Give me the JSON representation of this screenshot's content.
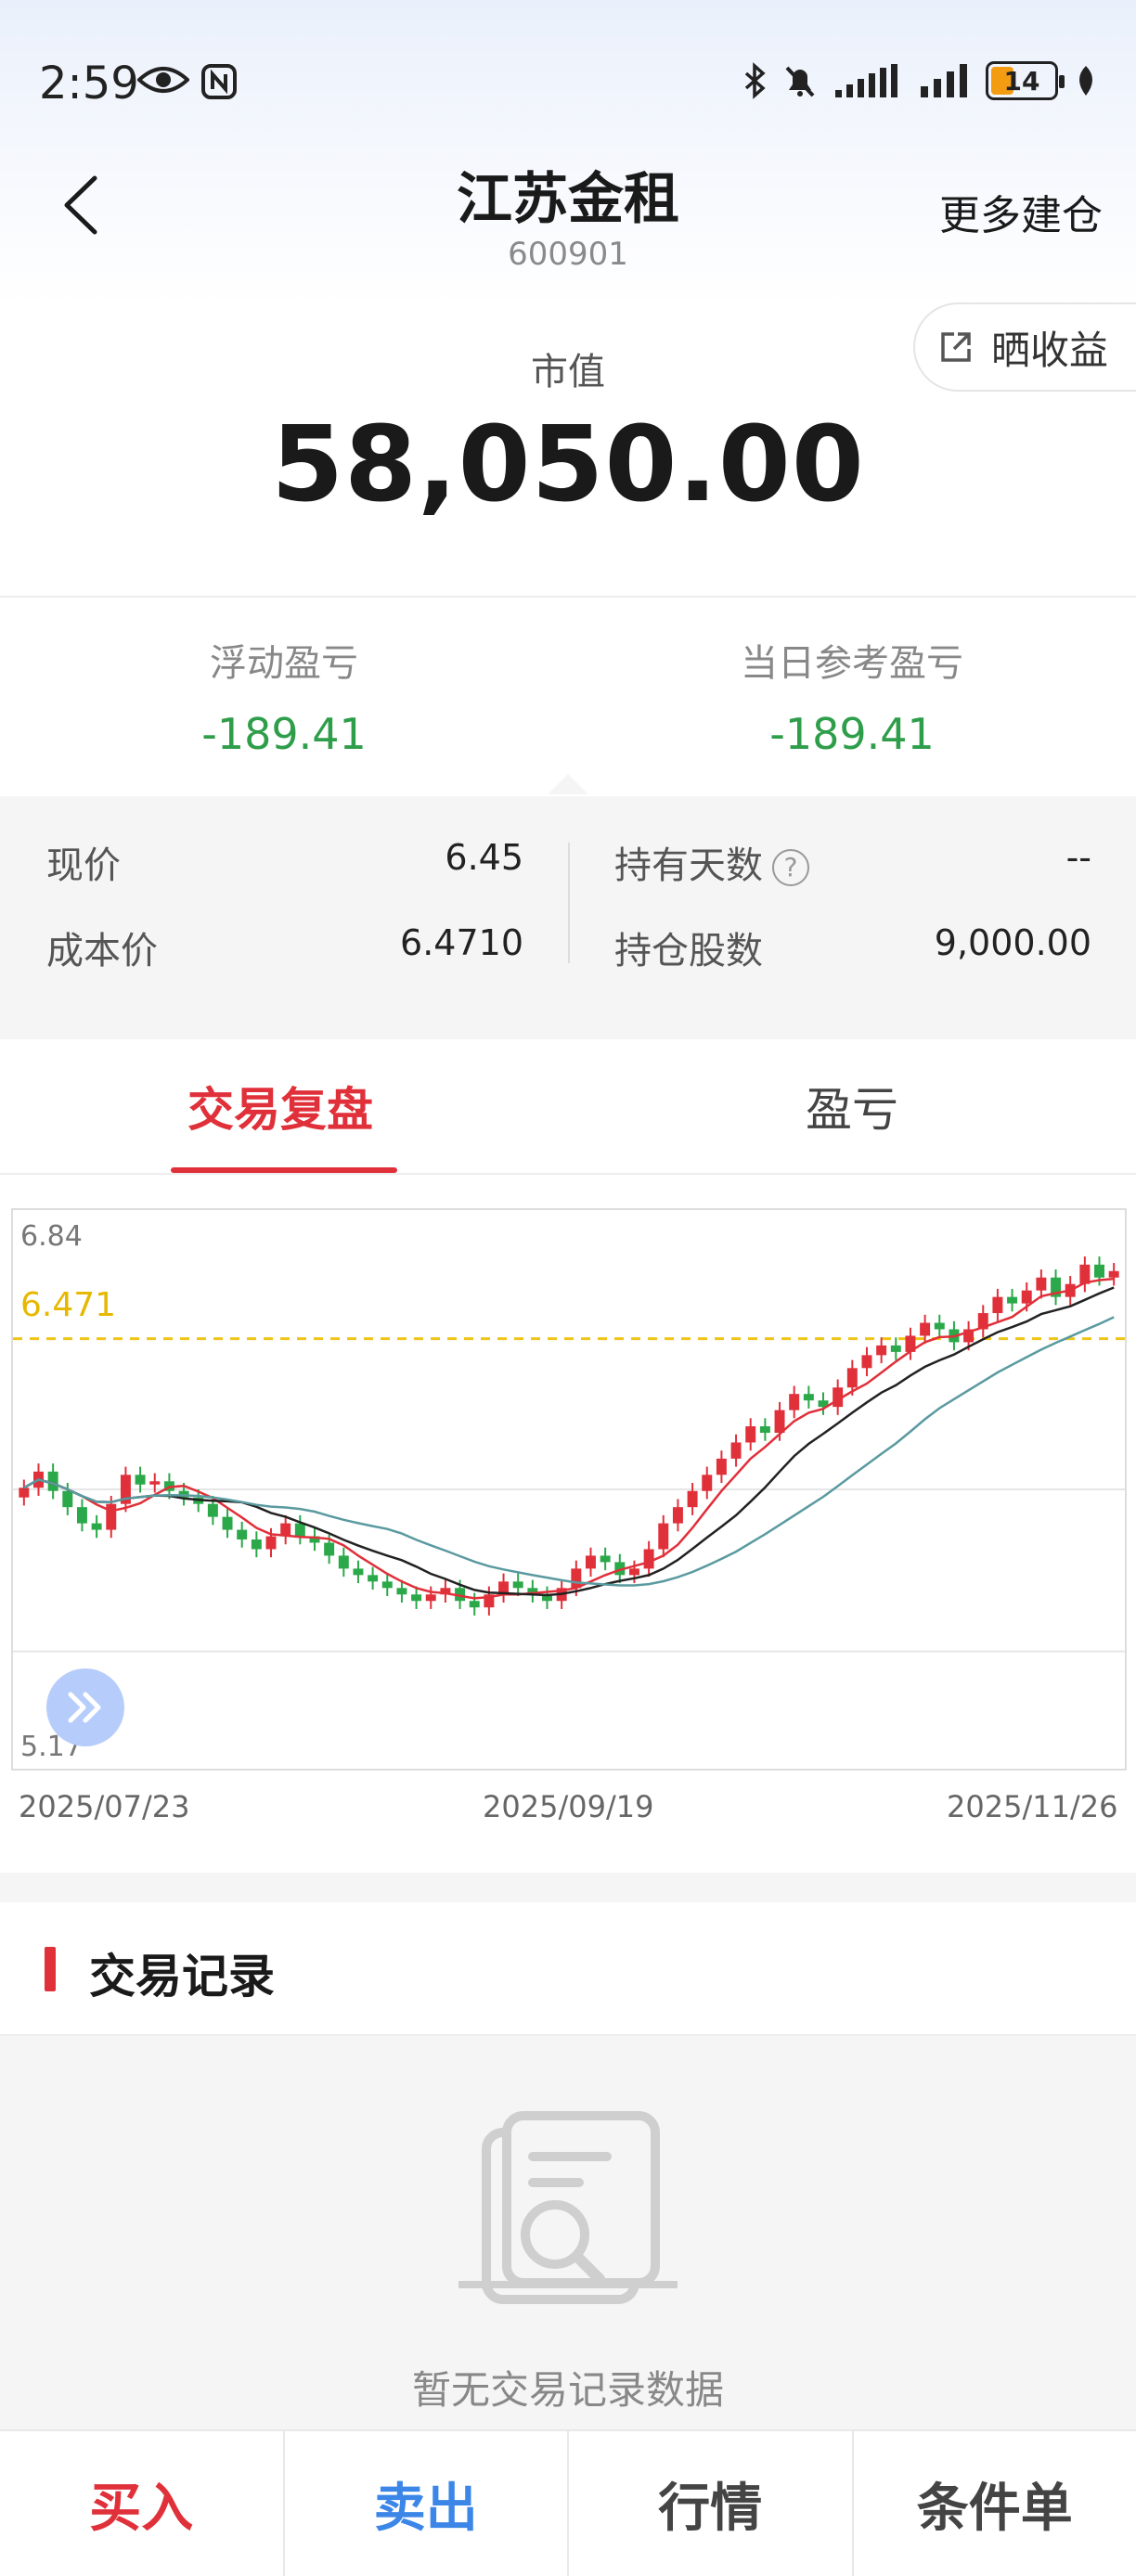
{
  "status_bar": {
    "time": "2:59",
    "battery": "14"
  },
  "header": {
    "title": "江苏金租",
    "code": "600901",
    "more_label": "更多建仓"
  },
  "summary": {
    "share_label": "晒收益",
    "market_value_label": "市值",
    "market_value": "58,050.00"
  },
  "pnl": {
    "floating_label": "浮动盈亏",
    "floating_value": "-189.41",
    "daily_label": "当日参考盈亏",
    "daily_value": "-189.41"
  },
  "details": {
    "price_label": "现价",
    "price_value": "6.45",
    "cost_label": "成本价",
    "cost_value": "6.4710",
    "days_label": "持有天数",
    "days_value": "--",
    "shares_label": "持仓股数",
    "shares_value": "9,000.00"
  },
  "tabs": [
    {
      "label": "交易复盘",
      "active": true
    },
    {
      "label": "盈亏",
      "active": false
    }
  ],
  "chart_data": {
    "type": "candlestick",
    "y_top_label": "6.84",
    "y_bottom_label": "5.17",
    "cost_line_label": "6.471",
    "ylim": [
      5.17,
      6.84
    ],
    "cost_line": 6.471,
    "x_labels": [
      "2025/07/23",
      "2025/09/19",
      "2025/11/26"
    ],
    "colors": {
      "up": "#e0303a",
      "down": "#2ba84a",
      "cost_line": "#f0c419",
      "ma5": "#e0303a",
      "ma10": "#222222",
      "ma20": "#5a9aa0"
    },
    "closes": [
      6.01,
      6.06,
      6.0,
      5.95,
      5.9,
      5.88,
      5.96,
      6.05,
      6.02,
      6.03,
      6.0,
      5.98,
      5.96,
      5.92,
      5.88,
      5.85,
      5.82,
      5.86,
      5.9,
      5.86,
      5.84,
      5.8,
      5.76,
      5.74,
      5.72,
      5.7,
      5.68,
      5.66,
      5.68,
      5.7,
      5.66,
      5.64,
      5.68,
      5.72,
      5.7,
      5.68,
      5.66,
      5.7,
      5.76,
      5.8,
      5.78,
      5.74,
      5.76,
      5.82,
      5.9,
      5.95,
      6.0,
      6.05,
      6.1,
      6.15,
      6.2,
      6.18,
      6.25,
      6.3,
      6.28,
      6.26,
      6.32,
      6.38,
      6.42,
      6.45,
      6.43,
      6.48,
      6.52,
      6.5,
      6.46,
      6.5,
      6.55,
      6.6,
      6.58,
      6.62,
      6.66,
      6.6,
      6.64,
      6.7,
      6.66,
      6.68
    ]
  },
  "records": {
    "title": "交易记录",
    "empty_text": "暂无交易记录数据"
  },
  "bottom_bar": {
    "buy": "买入",
    "sell": "卖出",
    "quote": "行情",
    "conditional": "条件单"
  }
}
